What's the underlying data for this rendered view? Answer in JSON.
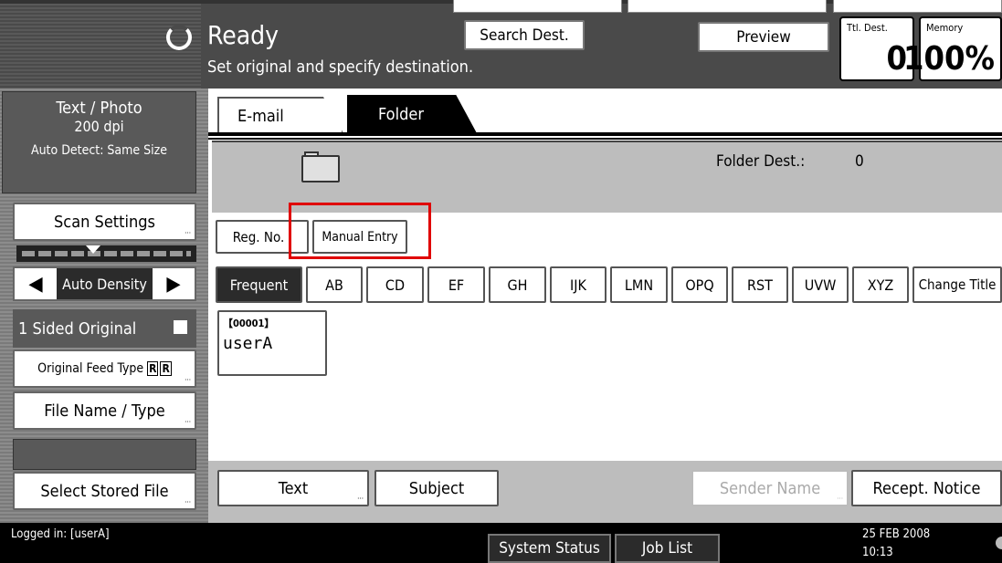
{
  "header": {
    "status_title": "Ready",
    "status_message": "Set original and specify destination.",
    "search_dest_label": "Search Dest.",
    "preview_label": "Preview",
    "ttl_dest_label": "Ttl. Dest.",
    "ttl_dest_value": "0",
    "memory_label": "Memory",
    "memory_value": "100%"
  },
  "sidebar": {
    "scan_mode": "Text / Photo",
    "resolution": "200 dpi",
    "size_detect": "Auto Detect: Same Size",
    "scan_settings_label": "Scan Settings",
    "density_label": "Auto Density",
    "sided_original_label": "1 Sided Original",
    "original_feed_type_label": "Original Feed Type",
    "file_name_type_label": "File Name / Type",
    "select_stored_file_label": "Select Stored File"
  },
  "tabs": {
    "email_label": "E-mail",
    "folder_label": "Folder"
  },
  "folder_panel": {
    "folder_dest_label": "Folder Dest.:",
    "folder_dest_count": "0"
  },
  "actions": {
    "reg_no_label": "Reg. No.",
    "manual_entry_label": "Manual Entry"
  },
  "letter_tabs": [
    "Frequent",
    "AB",
    "CD",
    "EF",
    "GH",
    "IJK",
    "LMN",
    "OPQ",
    "RST",
    "UVW",
    "XYZ",
    "Change Title"
  ],
  "destinations": [
    {
      "number": "【00001】",
      "name": "userA"
    }
  ],
  "bottom_buttons": {
    "text_label": "Text",
    "subject_label": "Subject",
    "sender_name_label": "Sender Name",
    "recept_notice_label": "Recept. Notice"
  },
  "status_bar": {
    "logged_in": "Logged in: [userA]",
    "system_status_label": "System Status",
    "job_list_label": "Job List",
    "date": "25 FEB  2008",
    "time": "10:13"
  }
}
